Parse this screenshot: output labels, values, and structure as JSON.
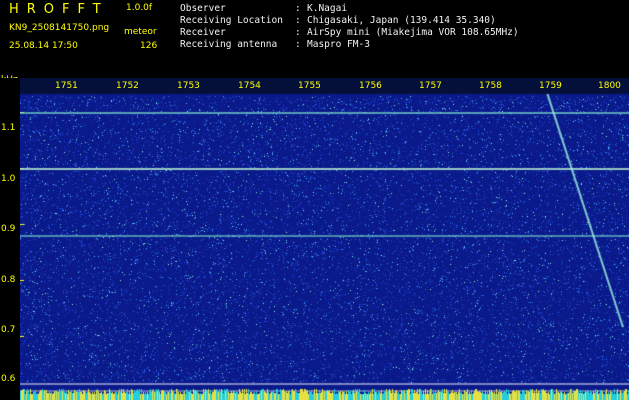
{
  "header": {
    "app_title": "HROFFT",
    "app_version": "1.0.0f",
    "file_name": "KN9_2508141750.png",
    "mode": "meteor",
    "datetime": "25.08.14 17:50",
    "count": "126",
    "info": [
      {
        "label": "Observer",
        "value": "K.Nagai"
      },
      {
        "label": "Receiving Location",
        "value": "Chigasaki, Japan (139.414 35.340)"
      },
      {
        "label": "Receiver",
        "value": "AirSpy mini (Miakejima VOR 108.65MHz)"
      },
      {
        "label": "Receiving antenna",
        "value": "Maspro FM-3"
      }
    ]
  },
  "plot": {
    "y_unit": "kHz",
    "y_ticks": [
      "1.1",
      "1.0",
      "0.9",
      "0.8",
      "0.7",
      "0.6"
    ],
    "y_tick_values": [
      1.1,
      1.0,
      0.9,
      0.8,
      0.7,
      0.6
    ],
    "y_range": [
      0.585,
      1.16
    ],
    "x_ticks": [
      "1751",
      "1752",
      "1753",
      "1754",
      "1755",
      "1756",
      "1757",
      "1758",
      "1759",
      "1800"
    ],
    "colors": {
      "background": "#0a1a8a",
      "noise_low": "#1e3cc8",
      "noise_high": "#6ad8ff",
      "carrier": "#7fe8d0",
      "tick_label": "#ffff00"
    }
  }
}
